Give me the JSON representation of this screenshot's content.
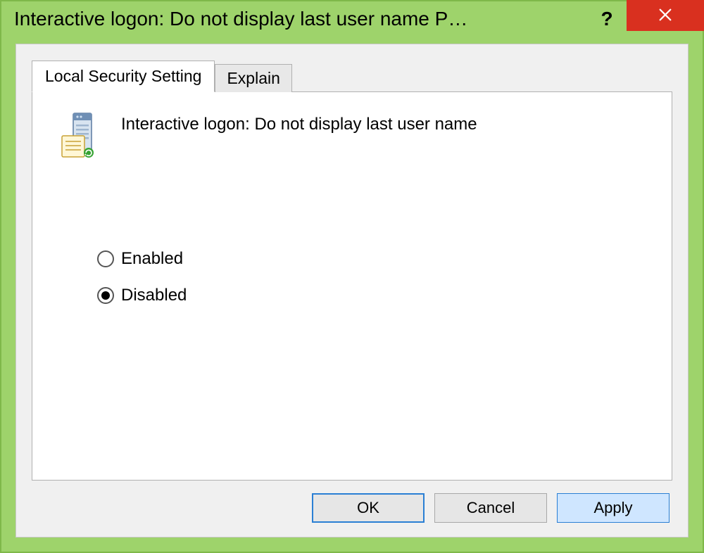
{
  "window": {
    "title": "Interactive logon: Do not display last user name P…"
  },
  "tabs": {
    "local": "Local Security Setting",
    "explain": "Explain"
  },
  "policy": {
    "name": "Interactive logon: Do not display last user name"
  },
  "options": {
    "enabled": "Enabled",
    "disabled": "Disabled",
    "selected": "disabled"
  },
  "buttons": {
    "ok": "OK",
    "cancel": "Cancel",
    "apply": "Apply"
  }
}
